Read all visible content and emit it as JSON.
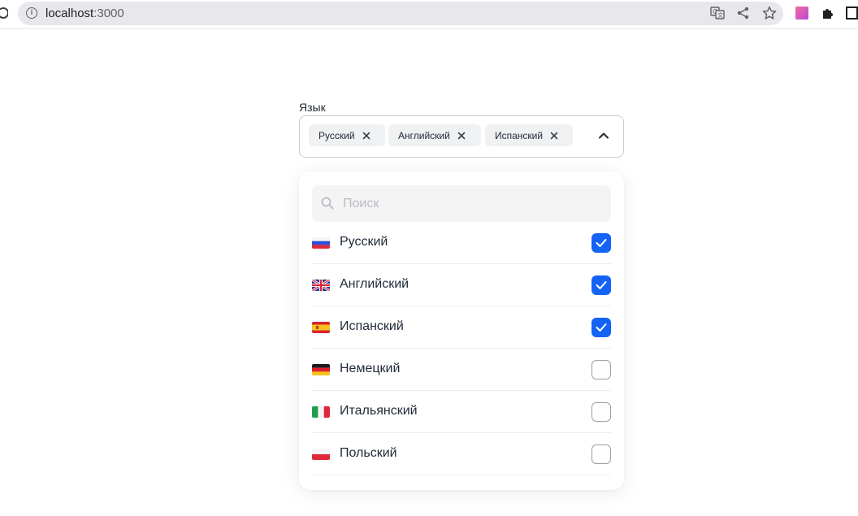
{
  "browser": {
    "url_host": "localhost",
    "url_port": ":3000",
    "icons": [
      "reload-icon",
      "info-icon",
      "translate-icon",
      "share-icon",
      "bookmark-star-icon",
      "extension-icon",
      "puzzle-icon",
      "sidebar-icon"
    ]
  },
  "field": {
    "label": "Язык",
    "selected_chips": [
      {
        "label": "Русский"
      },
      {
        "label": "Английский"
      },
      {
        "label": "Испанский"
      }
    ]
  },
  "dropdown": {
    "search_placeholder": "Поиск",
    "options": [
      {
        "label": "Русский",
        "checked": true,
        "flag": "ru"
      },
      {
        "label": "Английский",
        "checked": true,
        "flag": "gb"
      },
      {
        "label": "Испанский",
        "checked": true,
        "flag": "es"
      },
      {
        "label": "Немецкий",
        "checked": false,
        "flag": "de"
      },
      {
        "label": "Итальянский",
        "checked": false,
        "flag": "it"
      },
      {
        "label": "Польский",
        "checked": false,
        "flag": "pl"
      }
    ]
  },
  "colors": {
    "accent": "#1463f5",
    "chip_bg": "#f0f1f3",
    "search_bg": "#f4f4f5"
  }
}
